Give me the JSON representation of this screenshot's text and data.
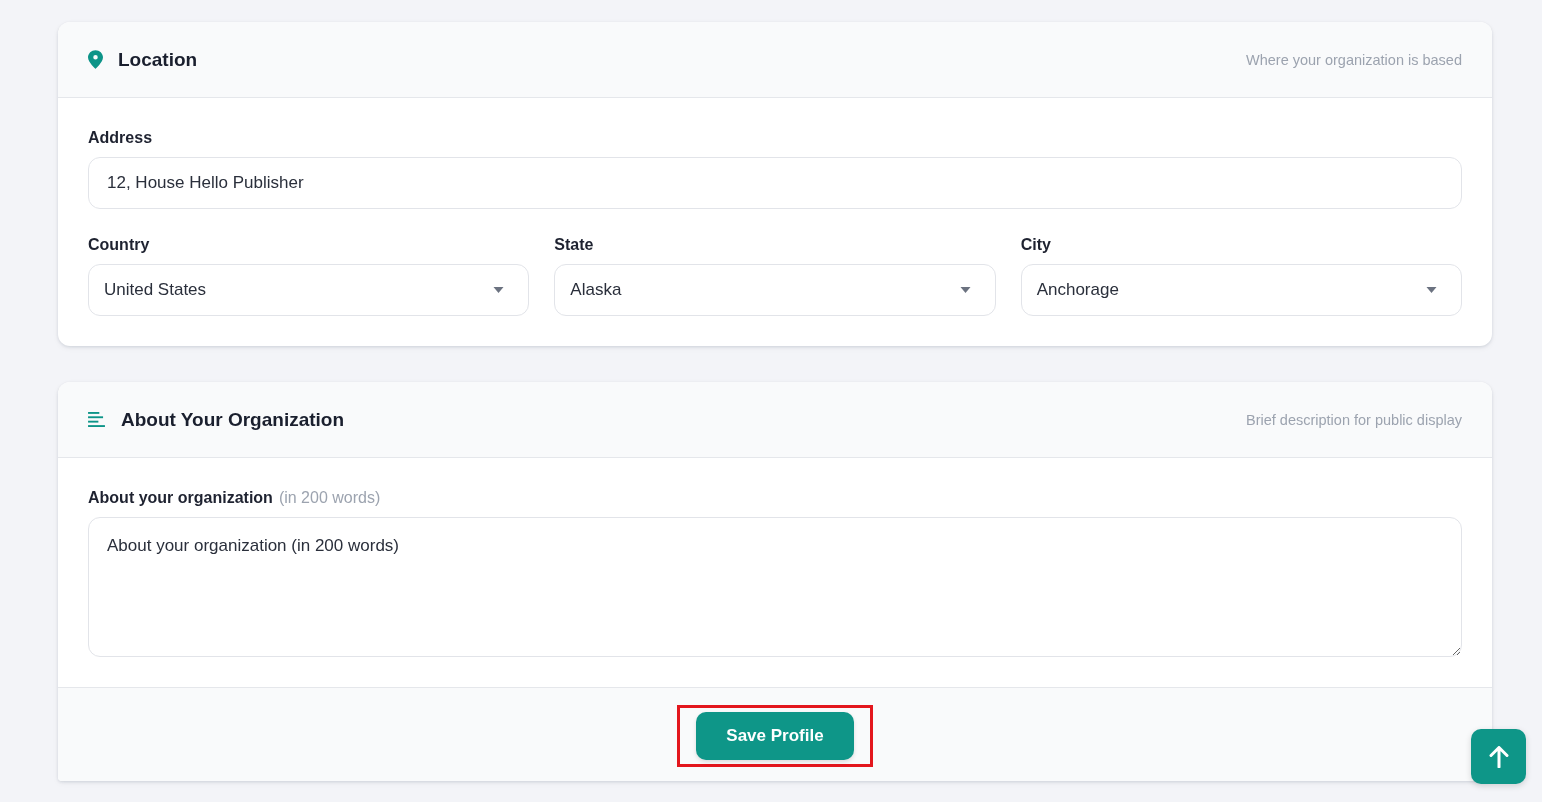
{
  "location_section": {
    "title": "Location",
    "subtitle": "Where your organization is based",
    "address": {
      "label": "Address",
      "value": "12, House Hello Publisher"
    },
    "selects": [
      {
        "label": "Country",
        "value": "United States"
      },
      {
        "label": "State",
        "value": "Alaska"
      },
      {
        "label": "City",
        "value": "Anchorage"
      }
    ]
  },
  "about_section": {
    "title": "About Your Organization",
    "subtitle": "Brief description for public display",
    "field": {
      "label": "About your organization",
      "hint": "(in 200 words)",
      "value": "About your organization (in 200 words)"
    },
    "save_button": {
      "label": "Save Profile",
      "highlighted": true
    }
  }
}
